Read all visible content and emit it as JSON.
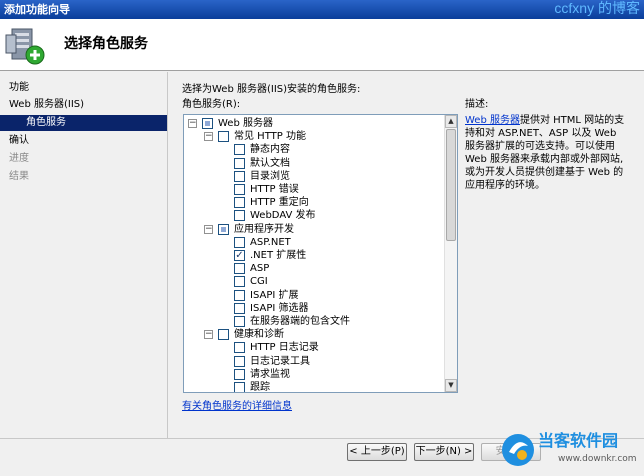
{
  "window": {
    "title": "添加功能向导",
    "watermark": "ccfxny 的博客"
  },
  "header": {
    "title": "选择角色服务"
  },
  "nav": {
    "items": [
      {
        "label": "功能",
        "state": "normal",
        "indent": false
      },
      {
        "label": "Web 服务器(IIS)",
        "state": "normal",
        "indent": false
      },
      {
        "label": "角色服务",
        "state": "active",
        "indent": true
      },
      {
        "label": "确认",
        "state": "normal",
        "indent": false
      },
      {
        "label": "进度",
        "state": "disabled",
        "indent": false
      },
      {
        "label": "结果",
        "state": "disabled",
        "indent": false
      }
    ]
  },
  "main": {
    "instruction": "选择为Web 服务器(IIS)安装的角色服务:",
    "list_label": "角色服务(R):",
    "description_label": "描述:",
    "description_link": "Web 服务器",
    "description_text": "提供对 HTML 网站的支持和对 ASP.NET、ASP 以及 Web 服务器扩展的可选支持。可以使用 Web 服务器来承载内部或外部网站,或为开发人员提供创建基于 Web 的应用程序的环境。",
    "details_link": "有关角色服务的详细信息"
  },
  "tree": [
    {
      "label": "Web 服务器",
      "level": 0,
      "expander": "minus",
      "check": "partial"
    },
    {
      "label": "常见 HTTP 功能",
      "level": 1,
      "expander": "minus",
      "check": "unchecked"
    },
    {
      "label": "静态内容",
      "level": 2,
      "expander": "",
      "check": "unchecked"
    },
    {
      "label": "默认文档",
      "level": 2,
      "expander": "",
      "check": "unchecked"
    },
    {
      "label": "目录浏览",
      "level": 2,
      "expander": "",
      "check": "unchecked"
    },
    {
      "label": "HTTP 错误",
      "level": 2,
      "expander": "",
      "check": "unchecked"
    },
    {
      "label": "HTTP 重定向",
      "level": 2,
      "expander": "",
      "check": "unchecked"
    },
    {
      "label": "WebDAV 发布",
      "level": 2,
      "expander": "",
      "check": "unchecked"
    },
    {
      "label": "应用程序开发",
      "level": 1,
      "expander": "minus",
      "check": "partial"
    },
    {
      "label": "ASP.NET",
      "level": 2,
      "expander": "",
      "check": "unchecked"
    },
    {
      "label": ".NET 扩展性",
      "level": 2,
      "expander": "",
      "check": "checked"
    },
    {
      "label": "ASP",
      "level": 2,
      "expander": "",
      "check": "unchecked"
    },
    {
      "label": "CGI",
      "level": 2,
      "expander": "",
      "check": "unchecked"
    },
    {
      "label": "ISAPI 扩展",
      "level": 2,
      "expander": "",
      "check": "unchecked"
    },
    {
      "label": "ISAPI 筛选器",
      "level": 2,
      "expander": "",
      "check": "unchecked"
    },
    {
      "label": "在服务器端的包含文件",
      "level": 2,
      "expander": "",
      "check": "unchecked"
    },
    {
      "label": "健康和诊断",
      "level": 1,
      "expander": "minus",
      "check": "unchecked"
    },
    {
      "label": "HTTP 日志记录",
      "level": 2,
      "expander": "",
      "check": "unchecked"
    },
    {
      "label": "日志记录工具",
      "level": 2,
      "expander": "",
      "check": "unchecked"
    },
    {
      "label": "请求监视",
      "level": 2,
      "expander": "",
      "check": "unchecked"
    },
    {
      "label": "跟踪",
      "level": 2,
      "expander": "",
      "check": "unchecked"
    }
  ],
  "buttons": {
    "prev": "< 上一步(P)",
    "next": "下一步(N) >",
    "install": "安装(I)"
  },
  "brand": {
    "name": "当客软件园",
    "url": "www.downkr.com"
  },
  "icons": {
    "wizard": "server-add-icon",
    "check_mark": "✓",
    "expander_minus": "−",
    "scroll_up": "▲",
    "scroll_down": "▼"
  },
  "colors": {
    "titlebar": "#0a3e9a",
    "nav_active": "#0a246a",
    "link": "#0033cc"
  }
}
